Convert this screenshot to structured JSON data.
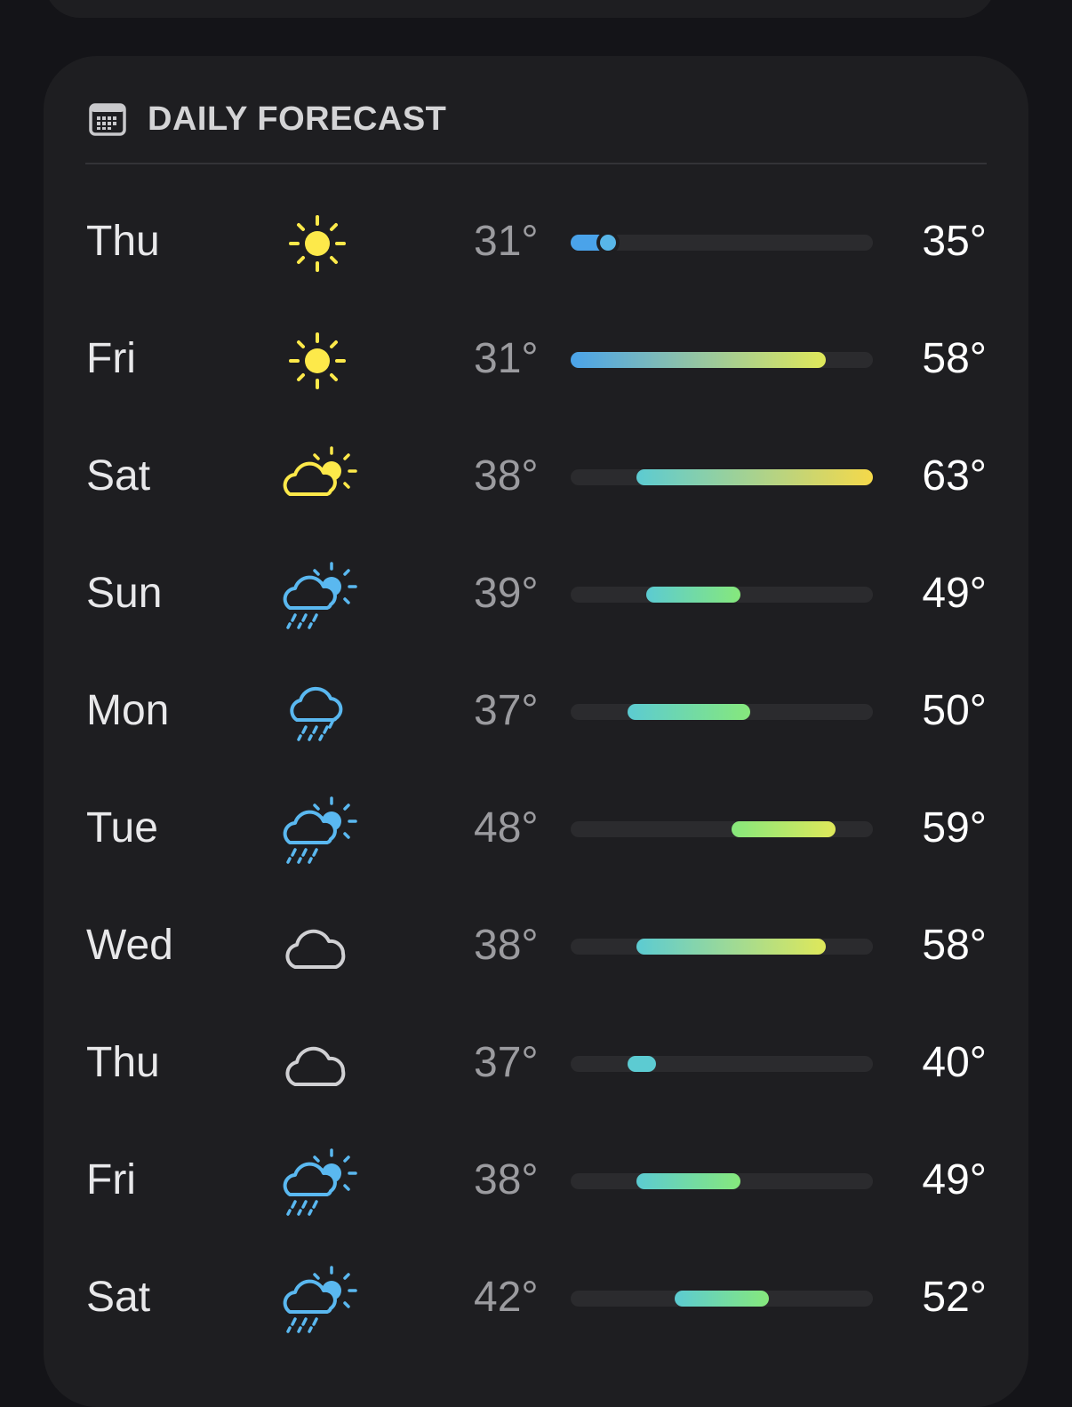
{
  "header": {
    "title": "DAILY FORECAST",
    "icon": "calendar-icon"
  },
  "scale": {
    "min": 31,
    "max": 63
  },
  "colors": {
    "cold": "#4aa3ea",
    "cool": "#5ccbd2",
    "mild": "#86e87c",
    "warm": "#dfe85a",
    "hot": "#f5d94a"
  },
  "days": [
    {
      "day": "Thu",
      "icon": "sun-icon",
      "low": "31°",
      "high": "35°",
      "low_val": 31,
      "high_val": 35,
      "current": 31
    },
    {
      "day": "Fri",
      "icon": "sun-icon",
      "low": "31°",
      "high": "58°",
      "low_val": 31,
      "high_val": 58
    },
    {
      "day": "Sat",
      "icon": "partly-cloudy-icon",
      "low": "38°",
      "high": "63°",
      "low_val": 38,
      "high_val": 63
    },
    {
      "day": "Sun",
      "icon": "sun-cloud-rain-icon",
      "low": "39°",
      "high": "49°",
      "low_val": 39,
      "high_val": 49
    },
    {
      "day": "Mon",
      "icon": "rain-icon",
      "low": "37°",
      "high": "50°",
      "low_val": 37,
      "high_val": 50
    },
    {
      "day": "Tue",
      "icon": "sun-cloud-rain-icon",
      "low": "48°",
      "high": "59°",
      "low_val": 48,
      "high_val": 59
    },
    {
      "day": "Wed",
      "icon": "cloud-icon",
      "low": "38°",
      "high": "58°",
      "low_val": 38,
      "high_val": 58
    },
    {
      "day": "Thu",
      "icon": "cloud-icon",
      "low": "37°",
      "high": "40°",
      "low_val": 37,
      "high_val": 40
    },
    {
      "day": "Fri",
      "icon": "sun-cloud-rain-icon",
      "low": "38°",
      "high": "49°",
      "low_val": 38,
      "high_val": 49
    },
    {
      "day": "Sat",
      "icon": "sun-cloud-rain-icon",
      "low": "42°",
      "high": "52°",
      "low_val": 42,
      "high_val": 52
    }
  ]
}
